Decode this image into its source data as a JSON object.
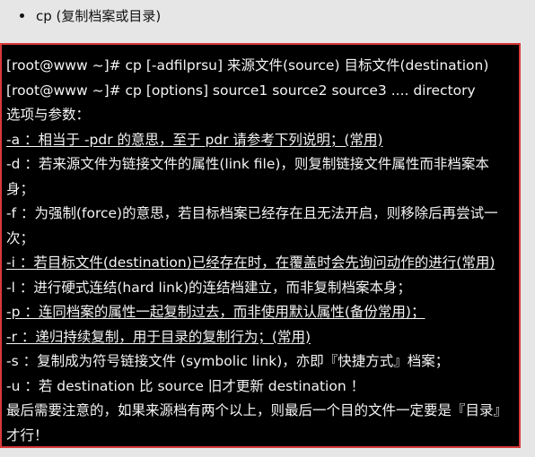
{
  "bullet": {
    "text": "cp (复制档案或目录)"
  },
  "terminal": {
    "lines": [
      "[root@www ~]# cp [-adfilprsu] 来源文件(source) 目标文件(destination)",
      "[root@www ~]# cp [options] source1 source2 source3 .... directory",
      "选项与参数：",
      "-a  ：相当于 -pdr 的意思，至于 pdr 请参考下列说明；(常用)",
      "-d  ：若来源文件为链接文件的属性(link file)，则复制链接文件属性而非档案本身；",
      "-f  ：为强制(force)的意思，若目标档案已经存在且无法开启，则移除后再尝试一次；",
      "-i  ：若目标文件(destination)已经存在时，在覆盖时会先询问动作的进行(常用)",
      "-l  ：进行硬式连结(hard link)的连结档建立，而非复制档案本身；",
      "-p  ：连同档案的属性一起复制过去，而非使用默认属性(备份常用)；",
      "-r  ：递归持续复制，用于目录的复制行为；(常用)",
      "-s  ：复制成为符号链接文件 (symbolic link)，亦即『快捷方式』档案；",
      "-u  ：若 destination 比 source 旧才更新 destination ！",
      "最后需要注意的，如果来源档有两个以上，则最后一个目的文件一定要是『目录』才行！"
    ]
  },
  "colors": {
    "background": "#e6e6e6",
    "terminal_bg": "#000000",
    "terminal_text": "#f4f4f4",
    "border": "#d93a3a"
  }
}
